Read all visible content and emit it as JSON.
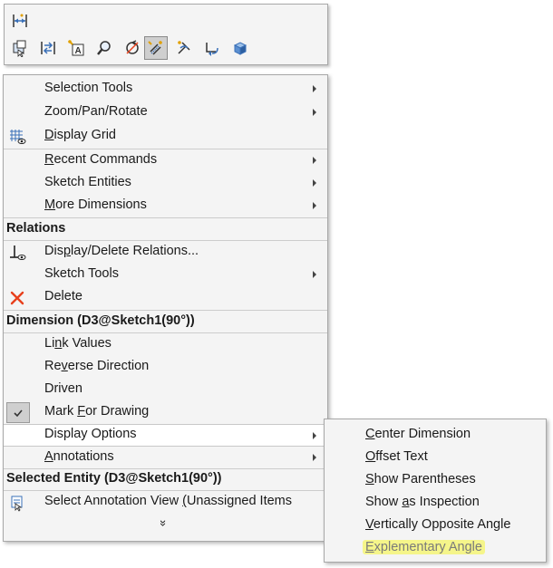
{
  "toolbar": {
    "buttons": [
      {
        "name": "horizontal-dimension-icon"
      },
      {
        "name": "select-other-icon"
      },
      {
        "name": "swap-icon"
      },
      {
        "name": "note-icon"
      },
      {
        "name": "zoom-icon"
      },
      {
        "name": "rotate-icon"
      },
      {
        "name": "smart-dimension-icon"
      },
      {
        "name": "pan-icon"
      },
      {
        "name": "undo-arrow-icon"
      },
      {
        "name": "component-icon"
      }
    ]
  },
  "menu": {
    "items": {
      "selection_tools": {
        "label": "Selection Tools"
      },
      "zoom_pan_rotate": {
        "label": "Zoom/Pan/Rotate"
      },
      "display_grid": {
        "pre": "",
        "u": "D",
        "post": "isplay Grid"
      },
      "recent_commands": {
        "pre": "",
        "u": "R",
        "post": "ecent Commands"
      },
      "sketch_entities": {
        "label": "Sketch Entities"
      },
      "more_dimensions": {
        "pre": "",
        "u": "M",
        "post": "ore Dimensions"
      },
      "display_delete_relations": {
        "pre": "Dis",
        "u": "p",
        "post": "lay/Delete Relations..."
      },
      "sketch_tools": {
        "label": "Sketch Tools"
      },
      "delete": {
        "label": "Delete"
      },
      "link_values": {
        "pre": "Li",
        "u": "n",
        "post": "k Values"
      },
      "reverse_direction": {
        "pre": "Re",
        "u": "v",
        "post": "erse Direction"
      },
      "driven": {
        "label": "Driven"
      },
      "mark_for_drawing": {
        "pre": "Mark ",
        "u": "F",
        "post": "or Drawing"
      },
      "display_options": {
        "label": "Display Options"
      },
      "annotations": {
        "pre": "",
        "u": "A",
        "post": "nnotations"
      },
      "select_annotation_view": {
        "pre": "Select Annotation View ",
        "u": "(",
        "post": "Unassigned Items"
      }
    },
    "headers": {
      "relations": "Relations",
      "dimension": "Dimension (D3@Sketch1(90°))",
      "selected_entity": "Selected Entity (D3@Sketch1(90°))"
    },
    "more": "»"
  },
  "submenu": {
    "center_dimension": {
      "pre": "",
      "u": "C",
      "post": "enter Dimension"
    },
    "offset_text": {
      "pre": "",
      "u": "O",
      "post": "ffset Text"
    },
    "show_parentheses": {
      "pre": "",
      "u": "S",
      "post": "how Parentheses"
    },
    "show_as_inspection": {
      "pre": "Show ",
      "u": "a",
      "post": "s Inspection"
    },
    "vertically_opposite_angle": {
      "pre": "",
      "u": "V",
      "post": "ertically Opposite Angle"
    },
    "explementary_angle": {
      "pre": "",
      "u": "E",
      "post": "xplementary Angle"
    }
  },
  "colors": {
    "highlight": "#f5f58a",
    "delete_red": "#e8401c",
    "icon_blue": "#3a70b8"
  }
}
